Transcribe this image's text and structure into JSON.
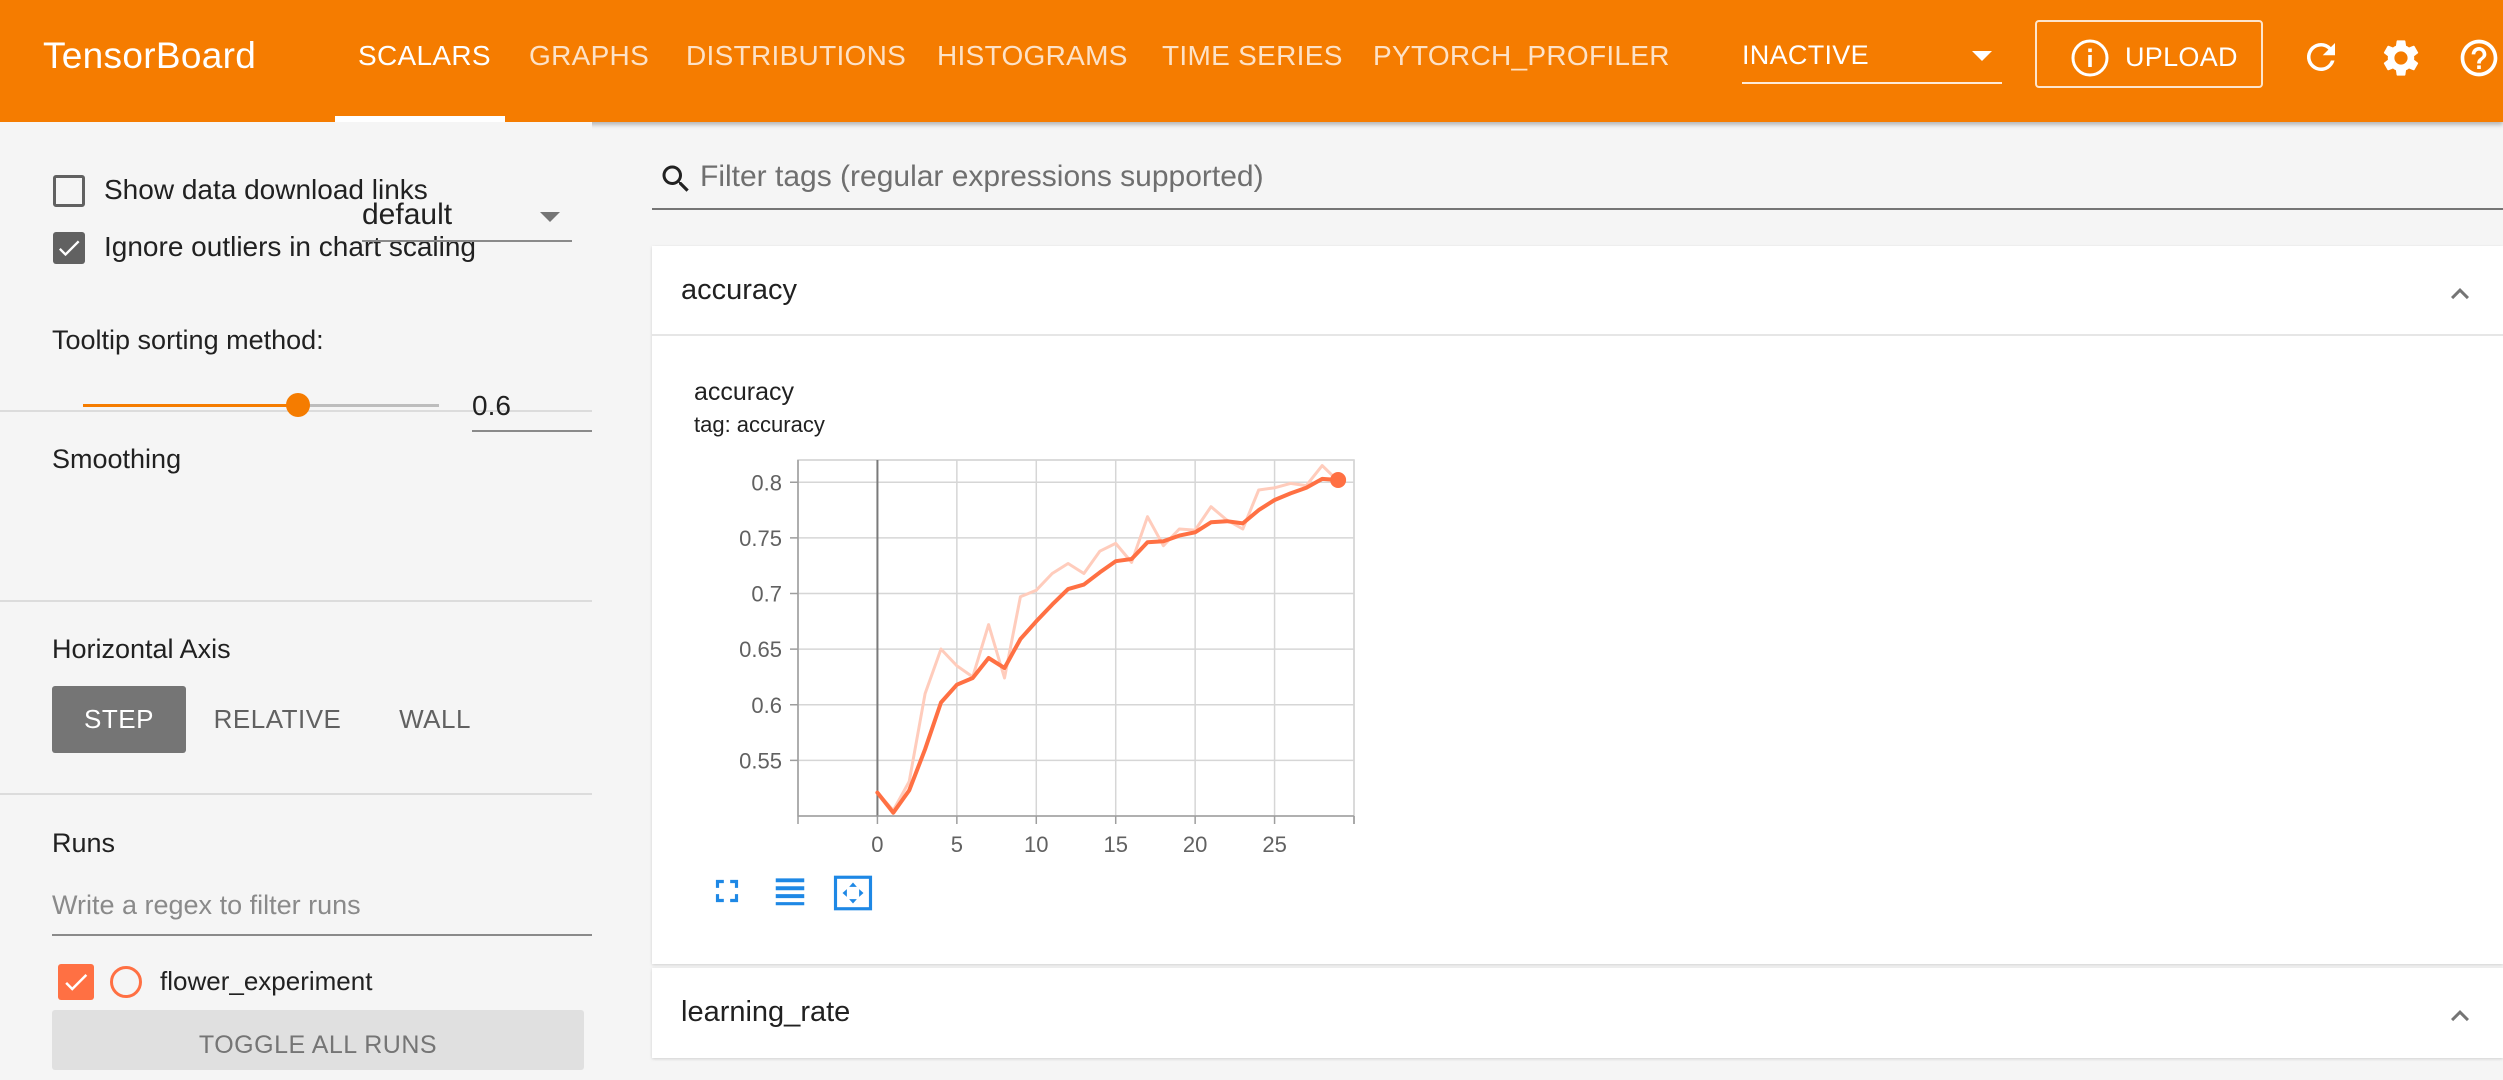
{
  "header": {
    "brand": "TensorBoard",
    "tabs": [
      {
        "label": "SCALARS",
        "active": true
      },
      {
        "label": "GRAPHS",
        "active": false
      },
      {
        "label": "DISTRIBUTIONS",
        "active": false
      },
      {
        "label": "HISTOGRAMS",
        "active": false
      },
      {
        "label": "TIME SERIES",
        "active": false
      },
      {
        "label": "PYTORCH_PROFILER",
        "active": false
      }
    ],
    "plugin_select": "INACTIVE",
    "upload_label": "UPLOAD",
    "icons": [
      "refresh-icon",
      "settings-icon",
      "help-icon"
    ],
    "accent_color": "#f57c00"
  },
  "sidebar": {
    "show_download_links": {
      "label": "Show data download links",
      "checked": false
    },
    "ignore_outliers": {
      "label": "Ignore outliers in chart scaling",
      "checked": true
    },
    "tooltip_sorting": {
      "label": "Tooltip sorting method:",
      "value": "default"
    },
    "smoothing": {
      "label": "Smoothing",
      "value": "0.6",
      "slider_level": 0.6
    },
    "horizontal_axis": {
      "label": "Horizontal Axis",
      "options": [
        "STEP",
        "RELATIVE",
        "WALL"
      ],
      "selected": "STEP"
    },
    "runs": {
      "label": "Runs",
      "filter_placeholder": "Write a regex to filter runs",
      "items": [
        {
          "name": "flower_experiment",
          "checked": true,
          "color": "#ff7043"
        }
      ],
      "toggle_all_label": "TOGGLE ALL RUNS"
    }
  },
  "main": {
    "search_placeholder": "Filter tags (regular expressions supported)",
    "cards": [
      {
        "title": "accuracy",
        "expanded": true
      },
      {
        "title": "learning_rate",
        "expanded": true
      }
    ],
    "chart_title": "accuracy",
    "chart_tag": "tag: accuracy",
    "chart_toolbar_icons": [
      "fullscreen-icon",
      "log-scale-icon",
      "fit-domain-icon"
    ]
  },
  "chart_data": {
    "type": "line",
    "title": "accuracy",
    "subtitle": "tag: accuracy",
    "xlabel": "",
    "ylabel": "",
    "xlim": [
      -5,
      30
    ],
    "ylim": [
      0.5,
      0.82
    ],
    "x_ticks": [
      0,
      5,
      10,
      15,
      20,
      25
    ],
    "y_ticks": [
      0.55,
      0.6,
      0.65,
      0.7,
      0.75,
      0.8
    ],
    "grid": true,
    "series": [
      {
        "name": "flower_experiment",
        "role": "raw",
        "color": "#ffccbc",
        "x": [
          0,
          1,
          2,
          3,
          4,
          5,
          6,
          7,
          8,
          9,
          10,
          11,
          12,
          13,
          14,
          15,
          16,
          17,
          18,
          19,
          20,
          21,
          22,
          23,
          24,
          25,
          26,
          27,
          28,
          29
        ],
        "y": [
          0.521,
          0.505,
          0.531,
          0.61,
          0.65,
          0.635,
          0.625,
          0.672,
          0.624,
          0.697,
          0.703,
          0.718,
          0.727,
          0.718,
          0.738,
          0.745,
          0.728,
          0.769,
          0.743,
          0.758,
          0.757,
          0.778,
          0.766,
          0.758,
          0.793,
          0.795,
          0.799,
          0.797,
          0.815,
          0.801
        ]
      },
      {
        "name": "flower_experiment",
        "role": "smoothed",
        "color": "#ff7043",
        "x": [
          0,
          1,
          2,
          3,
          4,
          5,
          6,
          7,
          8,
          9,
          10,
          11,
          12,
          13,
          14,
          15,
          16,
          17,
          18,
          19,
          20,
          21,
          22,
          23,
          24,
          25,
          26,
          27,
          28,
          29
        ],
        "y": [
          0.521,
          0.503,
          0.523,
          0.56,
          0.602,
          0.618,
          0.624,
          0.642,
          0.633,
          0.659,
          0.675,
          0.69,
          0.704,
          0.708,
          0.719,
          0.729,
          0.731,
          0.746,
          0.747,
          0.752,
          0.755,
          0.764,
          0.765,
          0.763,
          0.775,
          0.784,
          0.79,
          0.795,
          0.803,
          0.802
        ]
      }
    ]
  }
}
